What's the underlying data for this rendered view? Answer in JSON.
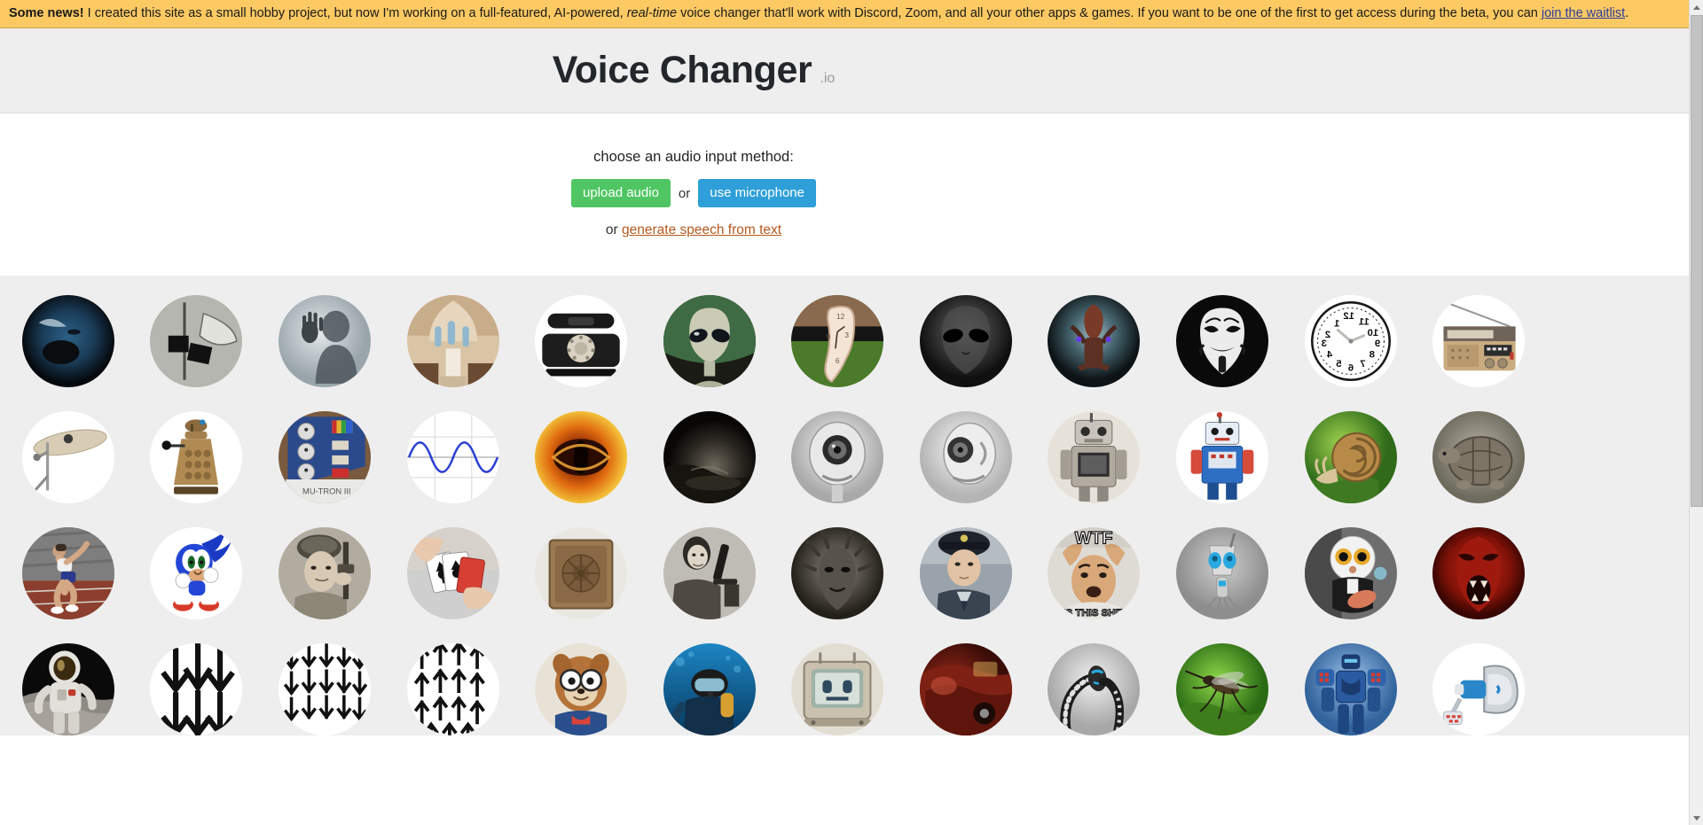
{
  "banner": {
    "lead": "Some news!",
    "text_1": " I created this site as a small hobby project, but now I'm working on a full-featured, AI-powered, ",
    "emphasis": "real-time",
    "text_2": " voice changer that'll work with Discord, Zoom, and all your other apps & games. If you want to be one of the first to get access during the beta, you can ",
    "link": "join the waitlist",
    "text_3": ".",
    "background_color": "#fcc963",
    "link_color": "#2b3ba0"
  },
  "header": {
    "title": "Voice Changer",
    "title_suffix": ".io",
    "background_color": "#eeeeee"
  },
  "chooser": {
    "prompt": "choose an audio input method:",
    "upload_label": "upload audio",
    "upload_color": "#4fc663",
    "or_label": "or",
    "microphone_label": "use microphone",
    "microphone_color": "#2e9fd8",
    "tts_prefix": "or ",
    "tts_link": "generate speech from text",
    "tts_link_color": "#b5581f"
  },
  "grid": {
    "columns": 12,
    "background_color": "#eeeeee",
    "avatars": [
      {
        "name": "screaming-monster-face",
        "icon": "monster-scream-icon"
      },
      {
        "name": "vintage-gramophone-horn",
        "icon": "gramophone-icon"
      },
      {
        "name": "shadow-figure-behind-glass",
        "icon": "ghost-silhouette-icon"
      },
      {
        "name": "cathedral-interior",
        "icon": "church-icon"
      },
      {
        "name": "rotary-telephone",
        "icon": "telephone-icon"
      },
      {
        "name": "grey-alien-face",
        "icon": "alien-icon"
      },
      {
        "name": "melting-clock",
        "icon": "melting-clock-icon"
      },
      {
        "name": "dark-alien-head",
        "icon": "dark-alien-icon"
      },
      {
        "name": "cyborg-insect-robot",
        "icon": "cyborg-icon"
      },
      {
        "name": "guy-fawkes-mask",
        "icon": "anonymous-mask-icon"
      },
      {
        "name": "reversed-wall-clock",
        "icon": "backwards-clock-icon"
      },
      {
        "name": "vintage-portable-radio",
        "icon": "radio-icon"
      },
      {
        "name": "drum-cymbal",
        "icon": "cymbal-icon"
      },
      {
        "name": "dalek-robot",
        "icon": "dalek-icon"
      },
      {
        "name": "mutron-effects-pedal",
        "icon": "effects-pedal-icon"
      },
      {
        "name": "sine-wave-graph",
        "icon": "sine-wave-icon"
      },
      {
        "name": "eye-of-sauron-fire",
        "icon": "fire-eye-icon"
      },
      {
        "name": "dark-cave-tunnel",
        "icon": "cave-icon"
      },
      {
        "name": "white-robot-head-front",
        "icon": "robot-head-icon"
      },
      {
        "name": "white-robot-head-side",
        "icon": "robot-head-side-icon"
      },
      {
        "name": "retro-tin-toy-robot",
        "icon": "toy-robot-icon"
      },
      {
        "name": "blue-tin-toy-robot",
        "icon": "blue-toy-robot-icon"
      },
      {
        "name": "garden-snail",
        "icon": "snail-icon"
      },
      {
        "name": "tortoise",
        "icon": "tortoise-icon"
      },
      {
        "name": "sprinting-athlete",
        "icon": "runner-icon"
      },
      {
        "name": "sonic-the-hedgehog",
        "icon": "sonic-icon"
      },
      {
        "name": "soldier-with-rifle",
        "icon": "soldier-icon"
      },
      {
        "name": "shuffling-playing-cards",
        "icon": "cards-icon"
      },
      {
        "name": "wooden-speaker-cabinet",
        "icon": "speaker-cabinet-icon"
      },
      {
        "name": "man-with-microscope",
        "icon": "microscope-icon"
      },
      {
        "name": "spiked-creature-portrait",
        "icon": "creature-icon"
      },
      {
        "name": "soviet-officer-portrait",
        "icon": "officer-icon"
      },
      {
        "name": "wtf-meme",
        "icon": "wtf-meme-icon"
      },
      {
        "name": "small-blue-eyed-robot",
        "icon": "cute-robot-icon"
      },
      {
        "name": "white-companion-robot",
        "icon": "companion-robot-icon"
      },
      {
        "name": "red-demon-face",
        "icon": "demon-icon"
      },
      {
        "name": "astronaut-on-moon",
        "icon": "astronaut-icon"
      },
      {
        "name": "large-down-arrows",
        "icon": "down-arrows-large-icon"
      },
      {
        "name": "small-down-arrows",
        "icon": "down-arrows-small-icon"
      },
      {
        "name": "up-arrows",
        "icon": "up-arrows-icon"
      },
      {
        "name": "chipmunk-character",
        "icon": "chipmunk-icon"
      },
      {
        "name": "scuba-diver-underwater",
        "icon": "scuba-diver-icon"
      },
      {
        "name": "retro-television-robot",
        "icon": "tv-robot-icon"
      },
      {
        "name": "vintage-car-interior",
        "icon": "vintage-car-icon"
      },
      {
        "name": "robotic-snake-arm",
        "icon": "robot-snake-icon"
      },
      {
        "name": "mosquito-on-leaf",
        "icon": "mosquito-icon"
      },
      {
        "name": "blue-mecha-robot",
        "icon": "mecha-icon"
      },
      {
        "name": "megaphone-bullhorn",
        "icon": "megaphone-icon"
      }
    ]
  },
  "scrollbar": {
    "up_arrow": "scroll-up",
    "down_arrow": "scroll-down"
  }
}
